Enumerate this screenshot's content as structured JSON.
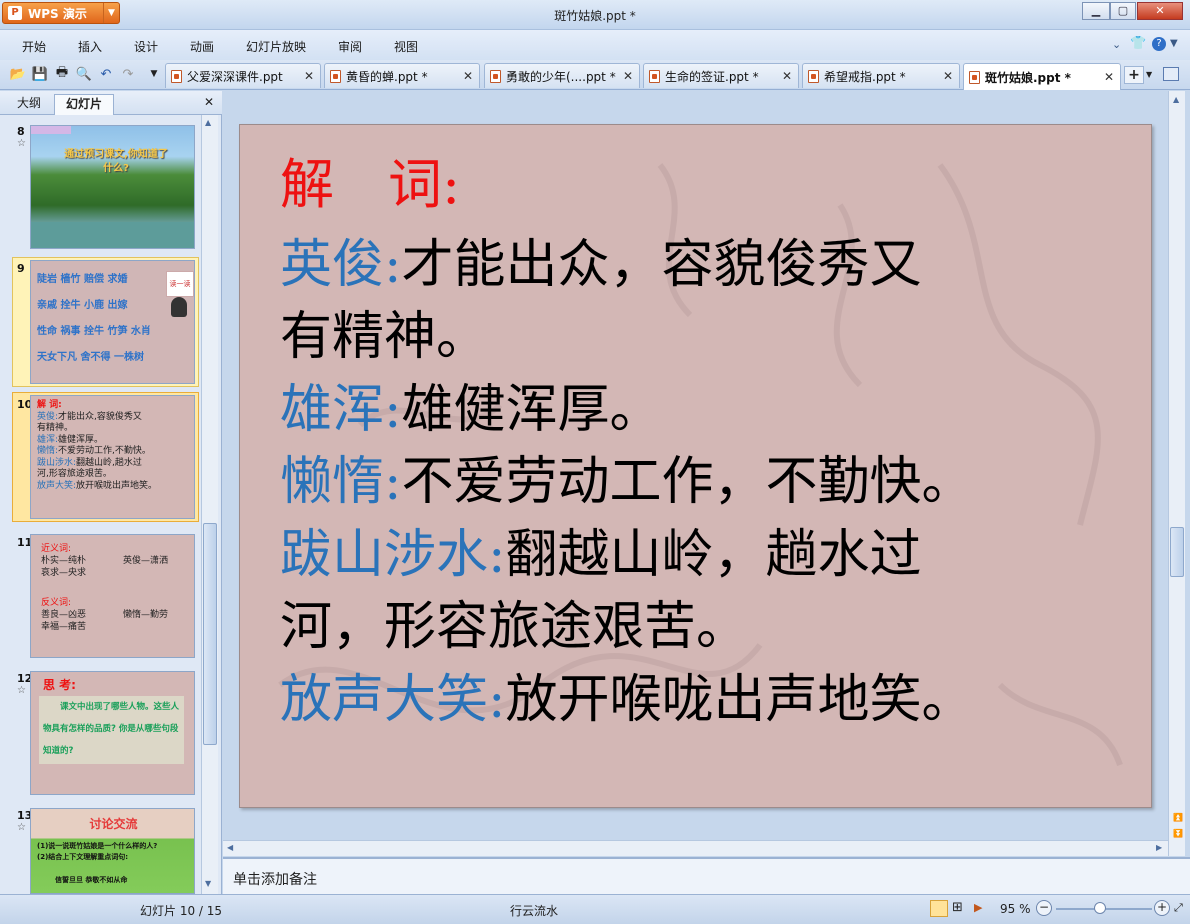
{
  "app": {
    "brand": "WPS 演示",
    "window_title": "斑竹姑娘.ppt *"
  },
  "menu": [
    "开始",
    "插入",
    "设计",
    "动画",
    "幻灯片放映",
    "审阅",
    "视图"
  ],
  "tabs": [
    {
      "label": "父爱深深课件.ppt"
    },
    {
      "label": "黄昏的蝉.ppt *"
    },
    {
      "label": "勇敢的少年(....ppt *"
    },
    {
      "label": "生命的签证.ppt *"
    },
    {
      "label": "希望戒指.ppt *"
    },
    {
      "label": "斑竹姑娘.ppt *",
      "active": true
    }
  ],
  "panel": {
    "tab_outline": "大纲",
    "tab_slides": "幻灯片"
  },
  "thumbnails": [
    {
      "num": "8",
      "star": "☆",
      "title": "通过预习课文,你知道了什么?"
    },
    {
      "num": "9",
      "words": [
        "陡岩 樯竹 赔偿 求婚",
        "亲戚 拴牛 小鹿 出嫁",
        "性命 祸事 拴牛 竹笋 水肖",
        "天女下凡 舍不得 一株树"
      ],
      "badge": "读一读"
    },
    {
      "num": "10",
      "head": "解 词:",
      "lines": [
        [
          "英俊:",
          "才能出众,容貌俊秀又"
        ],
        [
          "",
          "有精神。"
        ],
        [
          "雄浑:",
          "雄健浑厚。"
        ],
        [
          "懒惰:",
          "不爱劳动工作,不勤快。"
        ],
        [
          "跋山涉水:",
          "翻越山岭,趟水过"
        ],
        [
          "",
          "河,形容旅途艰苦。"
        ],
        [
          "放声大笑:",
          "放开喉咙出声地笑。"
        ]
      ]
    },
    {
      "num": "11",
      "syn_head": "近义词:",
      "syn": [
        "朴实—纯朴",
        "英俊—潇洒",
        "哀求—央求"
      ],
      "ant_head": "反义词:",
      "ant": [
        "善良—凶恶",
        "懒惰—勤劳",
        "幸福—痛苦"
      ]
    },
    {
      "num": "12",
      "star": "☆",
      "head": "思 考:",
      "text": "课文中出现了哪些人物。这些人物具有怎样的品质? 你是从哪些句段知道的?"
    },
    {
      "num": "13",
      "star": "☆",
      "head": "讨论交流",
      "items": [
        "(1)说一说斑竹姑娘是一个什么样的人?",
        "(2)结合上下文理解重点词句:"
      ],
      "extra": "信誓旦旦 恭敬不如从命"
    }
  ],
  "slide": {
    "heading": "解　词:",
    "rows": [
      {
        "term": "英俊:",
        "def": "才能出众，容貌俊秀又"
      },
      {
        "term": "",
        "def": "有精神。"
      },
      {
        "term": "雄浑:",
        "def": "雄健浑厚。"
      },
      {
        "term": "懒惰:",
        "def": "不爱劳动工作，不勤快。"
      },
      {
        "term": "跋山涉水:",
        "def": "翻越山岭，趟水过"
      },
      {
        "term": "",
        "def": "河，形容旅途艰苦。"
      },
      {
        "term": "放声大笑:",
        "def": "放开喉咙出声地笑。"
      }
    ]
  },
  "notes_placeholder": "单击添加备注",
  "status": {
    "slide_counter": "幻灯片 10 / 15",
    "theme": "行云流水",
    "zoom": "95 %"
  }
}
